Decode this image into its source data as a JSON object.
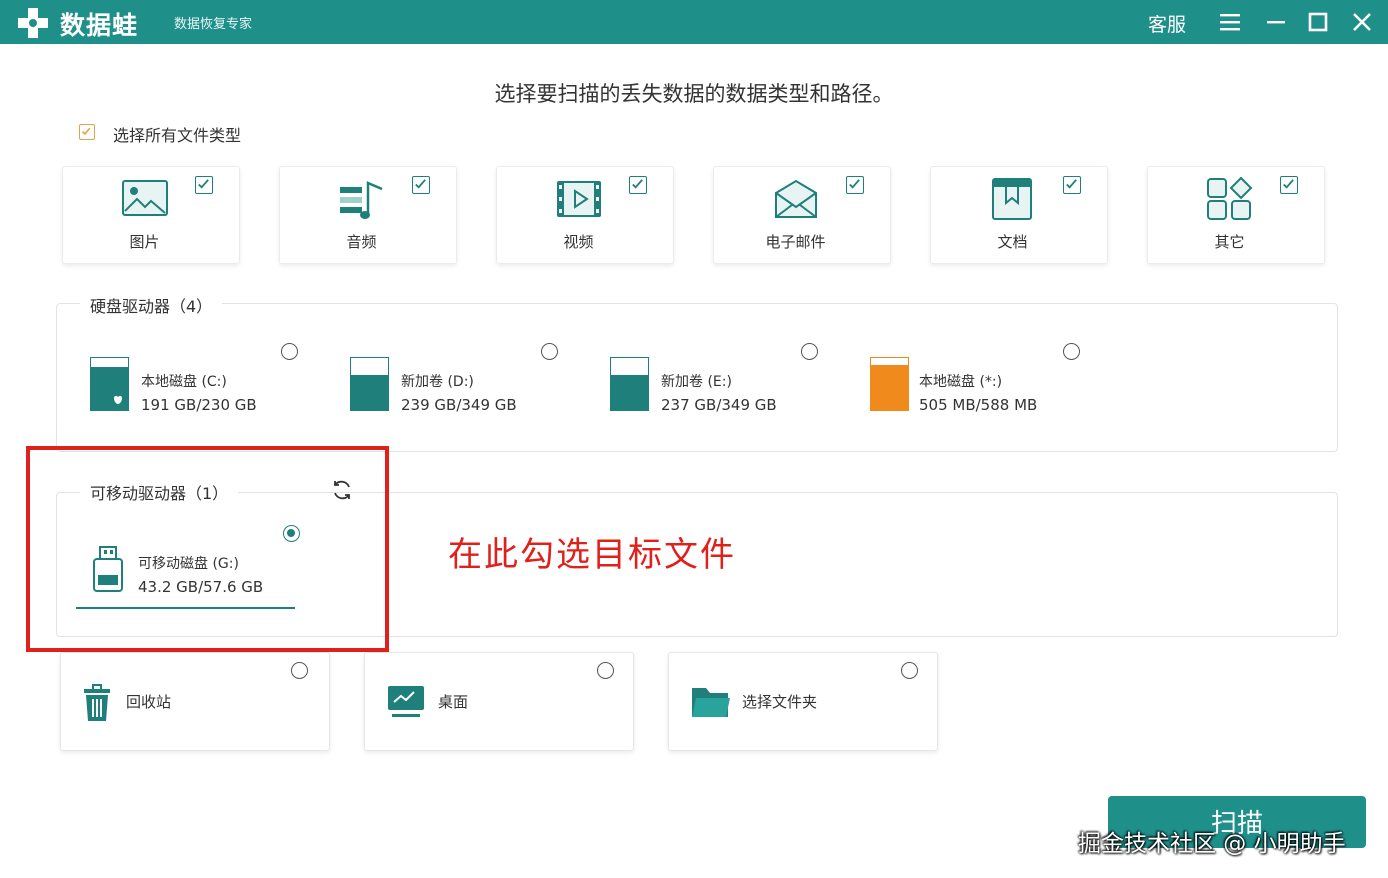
{
  "window": {
    "app_name": "数据蛙",
    "app_subtitle": "数据恢复专家",
    "service_label": "客服",
    "colors": {
      "title_bar": "#1f8f8a",
      "accent": "#1f7f7a",
      "orange_disk": "#f08a1c",
      "annotation_red": "#e0201b"
    }
  },
  "heading": "选择要扫描的丢失数据的数据类型和路径。",
  "select_all": {
    "label": "选择所有文件类型",
    "checked": true
  },
  "file_types": [
    {
      "label": "图片",
      "checked": true,
      "icon": "image-icon"
    },
    {
      "label": "音频",
      "checked": true,
      "icon": "music-icon"
    },
    {
      "label": "视频",
      "checked": true,
      "icon": "video-icon"
    },
    {
      "label": "电子邮件",
      "checked": true,
      "icon": "mail-icon"
    },
    {
      "label": "文档",
      "checked": true,
      "icon": "document-icon"
    },
    {
      "label": "其它",
      "checked": true,
      "icon": "other-icon"
    }
  ],
  "hard_drives": {
    "title": "硬盘驱动器（4）",
    "items": [
      {
        "name": "本地磁盘 (C:)",
        "size": "191 GB/230 GB",
        "used_fraction": 0.83,
        "selected": false
      },
      {
        "name": "新加卷 (D:)",
        "size": "239 GB/349 GB",
        "used_fraction": 0.68,
        "selected": false
      },
      {
        "name": "新加卷 (E:)",
        "size": "237 GB/349 GB",
        "used_fraction": 0.68,
        "selected": false
      },
      {
        "name": "本地磁盘 (*:)",
        "size": "505 MB/588 MB",
        "used_fraction": 0.86,
        "selected": false
      }
    ]
  },
  "removable": {
    "title": "可移动驱动器（1）",
    "items": [
      {
        "name": "可移动磁盘 (G:)",
        "size": "43.2 GB/57.6 GB",
        "selected": true
      }
    ]
  },
  "locations": [
    {
      "label": "回收站",
      "icon": "trash-icon",
      "selected": false
    },
    {
      "label": "桌面",
      "icon": "desktop-icon",
      "selected": false
    },
    {
      "label": "选择文件夹",
      "icon": "folder-icon",
      "selected": false
    }
  ],
  "annotation": "在此勾选目标文件",
  "scan_label": "扫描",
  "watermark": "掘金技术社区 @ 小明助手"
}
